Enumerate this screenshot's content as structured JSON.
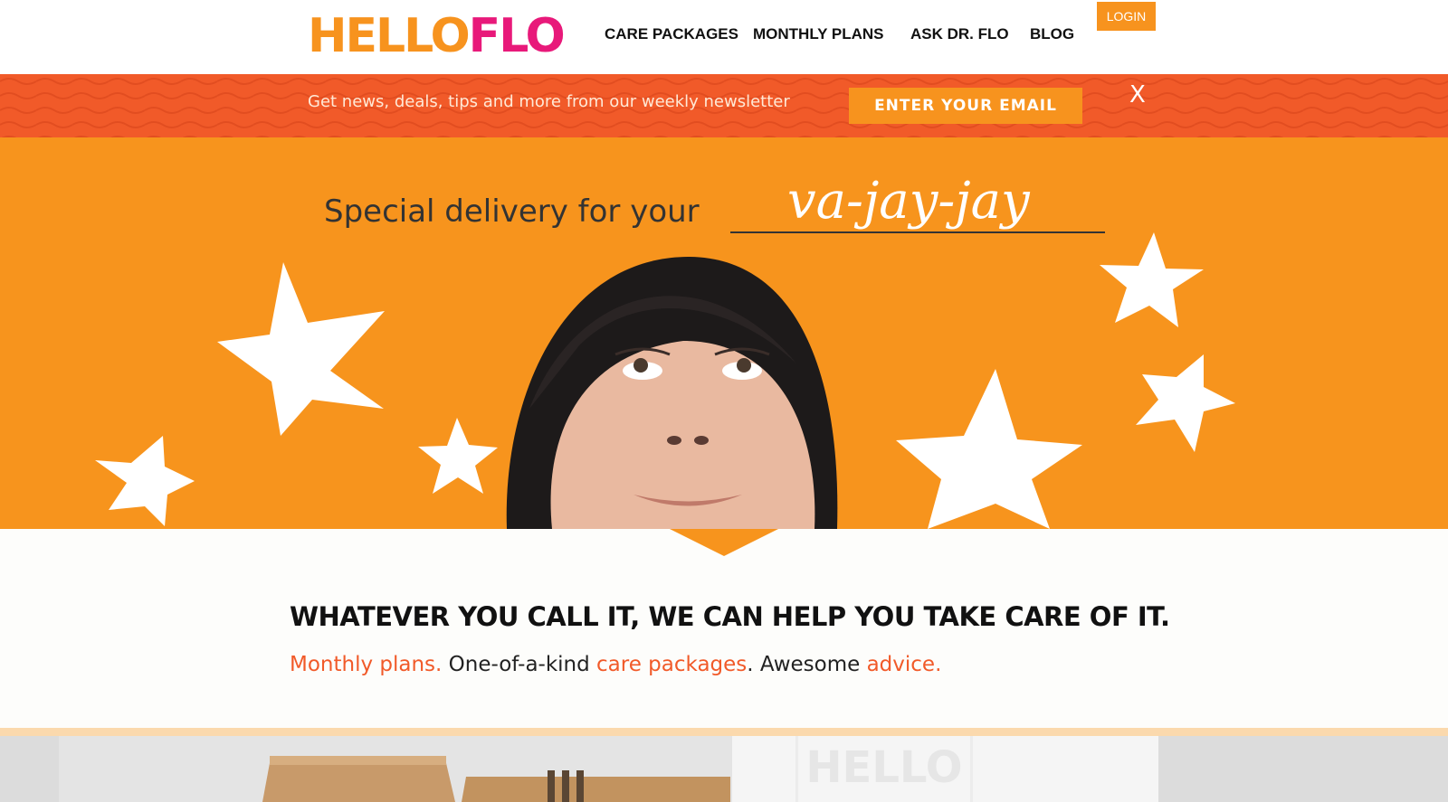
{
  "header": {
    "logo": {
      "part1": "HELLO",
      "part2": "FLO"
    },
    "nav": [
      {
        "label": "CARE PACKAGES"
      },
      {
        "label": "MONTHLY PLANS"
      },
      {
        "label": "ASK DR. FLO"
      },
      {
        "label": "BLOG"
      }
    ],
    "login_label": "LOGIN"
  },
  "newsletter": {
    "text": "Get news, deals, tips and more from our weekly newsletter",
    "button_label": "ENTER YOUR EMAIL",
    "close_label": "X"
  },
  "hero": {
    "title": "Special delivery for your",
    "word": "va-jay-jay"
  },
  "intro": {
    "tagline": "WHATEVER YOU CALL IT, WE CAN HELP YOU TAKE CARE OF IT.",
    "sub": {
      "link1": "Monthly plans.",
      "text1": " One-of-a-kind ",
      "link2": "care packages",
      "text2": ". Awesome ",
      "link3": "advice."
    }
  },
  "product_photo": {
    "box_text": "HELLO"
  },
  "colors": {
    "orange": "#f7941d",
    "red_orange": "#f15a29",
    "pink": "#e8197a",
    "stripe": "#fbd9ad"
  }
}
